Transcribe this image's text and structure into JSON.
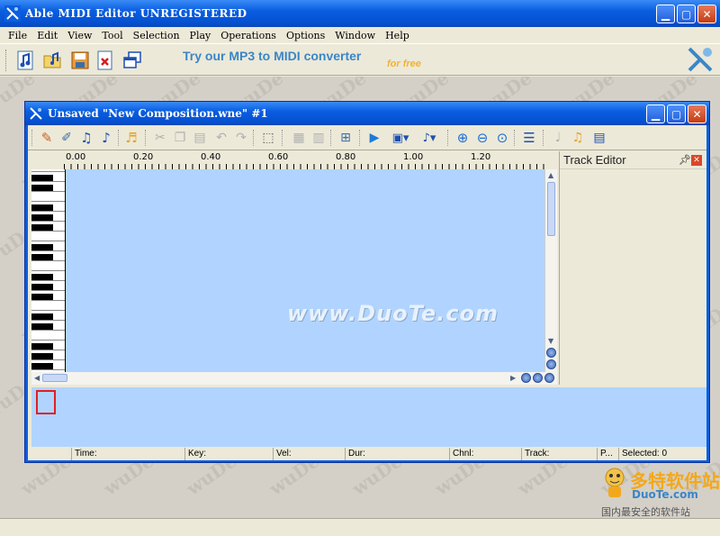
{
  "app": {
    "title": "Able MIDI Editor UNREGISTERED"
  },
  "menu": [
    "File",
    "Edit",
    "View",
    "Tool",
    "Selection",
    "Play",
    "Operations",
    "Options",
    "Window",
    "Help"
  ],
  "toolbar": {
    "promo_text": "Try our MP3 to MIDI converter",
    "promo_free": "for free",
    "buttons": [
      "new-music-icon",
      "open-icon",
      "save-icon",
      "close-doc-icon",
      "cascade-icon"
    ]
  },
  "child": {
    "title": "Unsaved \"New Composition.wne\" #1"
  },
  "ruler": {
    "labels": [
      "0.00",
      "0.20",
      "0.40",
      "0.60",
      "0.80",
      "1.00",
      "1.20"
    ]
  },
  "grid": {
    "watermark": "www.DuoTe.com"
  },
  "track_editor": {
    "title": "Track Editor"
  },
  "status": {
    "time": "Time:",
    "key": "Key:",
    "vel": "Vel:",
    "dur": "Dur:",
    "chnl": "Chnl:",
    "track": "Track:",
    "p": "P...",
    "selected": "Selected: 0"
  },
  "corner_logo": {
    "big": "多特软件站",
    "domain": "DuoTe.com",
    "sub": "国内最安全的软件站"
  },
  "workspace_watermark": "wuDe",
  "colors": {
    "title_blue": "#0a5ee0",
    "grid_bg": "#b0d4ff",
    "promo_blue": "#3a86c8",
    "promo_orange": "#f2b233"
  }
}
